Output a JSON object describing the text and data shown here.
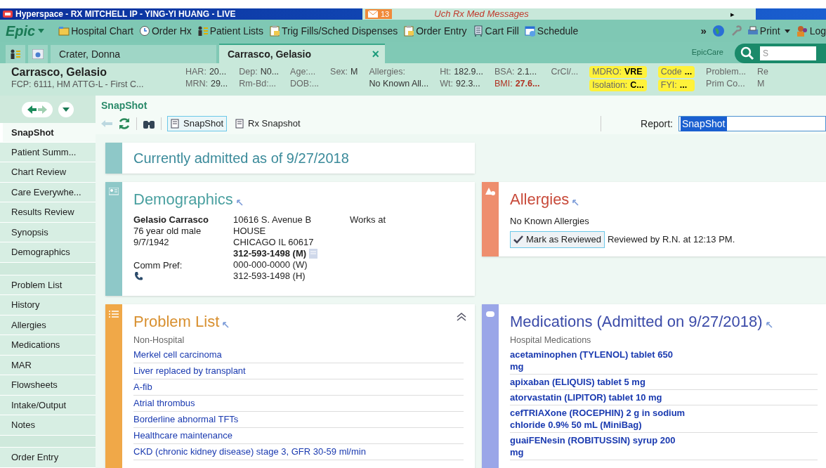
{
  "window": {
    "title": "Hyperspace - RX MITCHELL IP - YING-YI HUANG - LIVE",
    "message_count": "13",
    "message_label": "Uch Rx Med Messages",
    "message_arrow": "▸"
  },
  "toolbar": {
    "brand": "Epic",
    "items": [
      {
        "label": "Hospital Chart",
        "kind": "chart"
      },
      {
        "label": "Order Hx",
        "kind": "clock"
      },
      {
        "label": "Patient Lists",
        "kind": "list"
      },
      {
        "label": "Trig Fills/Sched Dispenses",
        "kind": "clipboard"
      },
      {
        "label": "Order Entry",
        "kind": "clipboard"
      },
      {
        "label": "Cart Fill",
        "kind": "cart"
      },
      {
        "label": "Schedule",
        "kind": "calendar"
      }
    ],
    "more": "»",
    "print": "Print",
    "log": "Log"
  },
  "tabs": [
    {
      "label": "Crater, Donna",
      "selected": false
    },
    {
      "label": "Carrasco, Gelasio",
      "selected": true
    }
  ],
  "tab_close": "×",
  "app_name": "EpicCare",
  "search": {
    "placeholder": "S"
  },
  "patient_header": {
    "name": "Carrasco, Gelasio",
    "fcp": "FCP: 6111, HM ATTG-L - First C...",
    "columns": [
      {
        "flagged": false,
        "lines": [
          {
            "label": "HAR:",
            "value": "20...",
            "alert": false
          },
          {
            "label": "MRN:",
            "value": "29...",
            "alert": false
          }
        ]
      },
      {
        "flagged": false,
        "lines": [
          {
            "label": "Dep:",
            "value": "N0...",
            "alert": false
          },
          {
            "label": "Rm-Bd:...",
            "alert": false
          }
        ]
      },
      {
        "flagged": false,
        "lines": [
          {
            "label": "Age:...",
            "alert": false
          },
          {
            "label": "DOB:...",
            "alert": false
          }
        ]
      },
      {
        "flagged": false,
        "lines": [
          {
            "label": "Sex:",
            "value": "M",
            "alert": false
          }
        ]
      },
      {
        "flagged": false,
        "lines": [
          {
            "label": "Allergies:",
            "alert": false
          },
          {
            "value": "No Known All...",
            "alert": false
          }
        ]
      },
      {
        "flagged": false,
        "lines": [
          {
            "label": "Ht:",
            "value": "182.9...",
            "alert": false
          },
          {
            "label": "Wt:",
            "value": "92.3...",
            "alert": false
          }
        ]
      },
      {
        "flagged": false,
        "lines": [
          {
            "label": "BSA:",
            "value": "2.1...",
            "alert": false
          },
          {
            "label": "BMI:",
            "value": "27.6...",
            "alert": true
          }
        ]
      },
      {
        "flagged": false,
        "lines": [
          {
            "label": "CrCl/...",
            "alert": false
          }
        ]
      },
      {
        "flagged": true,
        "lines": [
          {
            "label": "MDRO:",
            "value": "VRE",
            "alert": false
          },
          {
            "label": "Isolation:",
            "value": "C...",
            "alert": false
          }
        ]
      },
      {
        "flagged": true,
        "lines": [
          {
            "label": "Code",
            "value": "...",
            "alert": false
          },
          {
            "label": "FYI:",
            "value": "...",
            "alert": false
          }
        ]
      },
      {
        "flagged": false,
        "lines": [
          {
            "label": "Problem...",
            "alert": false
          },
          {
            "label": "Prim Co...",
            "alert": false
          }
        ]
      },
      {
        "flagged": false,
        "lines": [
          {
            "label": "Re",
            "alert": false
          },
          {
            "label": "M",
            "alert": false
          }
        ]
      }
    ]
  },
  "sidebar": {
    "groups": [
      [
        {
          "label": "SnapShot",
          "selected": true
        },
        {
          "label": "Patient Summ...",
          "selected": false
        },
        {
          "label": "Chart Review",
          "selected": false
        },
        {
          "label": "Care Everywhe...",
          "selected": false
        },
        {
          "label": "Results Review",
          "selected": false
        },
        {
          "label": "Synopsis",
          "selected": false
        },
        {
          "label": "Demographics",
          "selected": false
        }
      ],
      [
        {
          "label": "Problem List",
          "selected": false
        },
        {
          "label": "History",
          "selected": false
        },
        {
          "label": "Allergies",
          "selected": false
        },
        {
          "label": "Medications",
          "selected": false
        },
        {
          "label": "MAR",
          "selected": false
        },
        {
          "label": "Flowsheets",
          "selected": false
        },
        {
          "label": "Intake/Output",
          "selected": false
        },
        {
          "label": "Notes",
          "selected": false
        }
      ],
      [
        {
          "label": "Order Entry",
          "selected": false
        }
      ]
    ]
  },
  "activity": {
    "title": "SnapShot",
    "reports": [
      {
        "label": "SnapShot",
        "selected": true
      },
      {
        "label": "Rx Snapshot",
        "selected": false
      }
    ],
    "report_label": "Report:",
    "report_value": "SnapShot"
  },
  "admitted_banner": "Currently admitted as of 9/27/2018",
  "demographics": {
    "title": "Demographics",
    "name": "Gelasio Carrasco",
    "age_sex": "76 year old male",
    "dob": "9/7/1942",
    "comm_pref": "Comm Pref:",
    "address": [
      "10616 S. Avenue B",
      "HOUSE",
      "CHICAGO IL 60617"
    ],
    "phones": [
      {
        "text": "312-593-1498 (M)",
        "primary": true
      },
      {
        "text": "000-000-0000 (W)",
        "primary": false
      },
      {
        "text": "312-593-1498 (H)",
        "primary": false
      }
    ],
    "employer": "Works at"
  },
  "allergies": {
    "title": "Allergies",
    "status": "No Known Allergies",
    "review_button": "Mark as Reviewed",
    "reviewed": "Reviewed by R.N. at 12:13 PM."
  },
  "problem_list": {
    "title": "Problem List",
    "section": "Non-Hospital",
    "items": [
      "Merkel cell carcinoma",
      "Liver replaced by transplant",
      "A-fib",
      "Atrial thrombus",
      "Borderline abnormal TFTs",
      "Healthcare maintenance",
      "CKD (chronic kidney disease) stage 3, GFR 30-59 ml/min"
    ]
  },
  "medications": {
    "title": "Medications (Admitted on 9/27/2018)",
    "section": "Hospital Medications",
    "items": [
      "acetaminophen (TYLENOL) tablet 650 mg",
      "apixaban (ELIQUIS) tablet 5 mg",
      "atorvastatin (LIPITOR) tablet 10 mg",
      "cefTRIAXone (ROCEPHIN) 2 g in sodium chloride 0.9% 50 mL (MiniBag)",
      "guaiFENesin (ROBITUSSIN) syrup 200 mg"
    ]
  }
}
